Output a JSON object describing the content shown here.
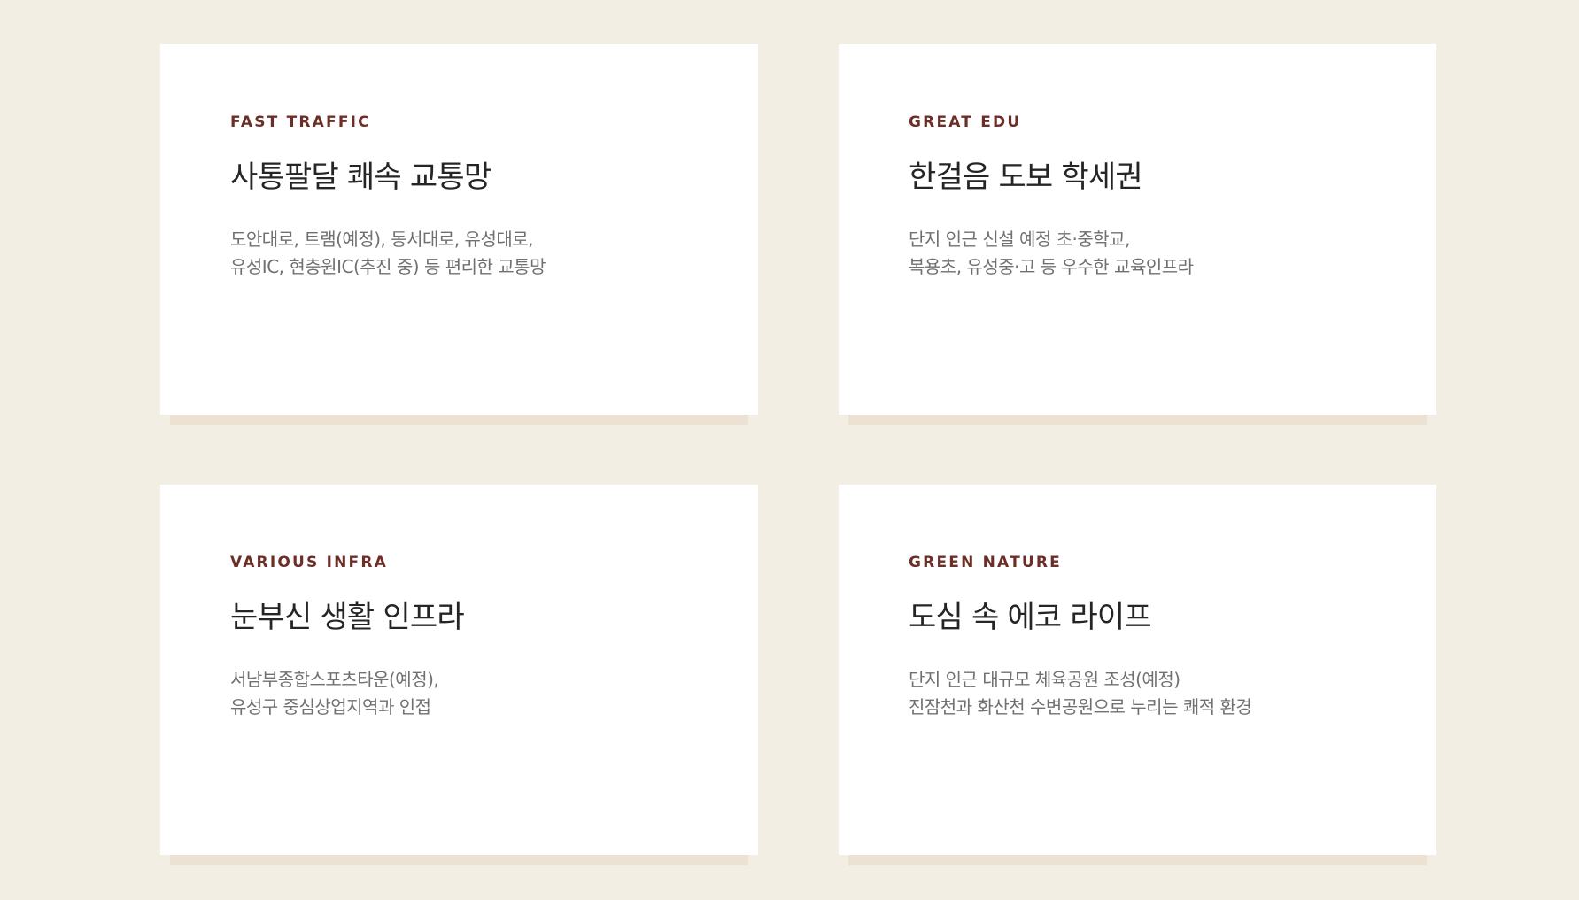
{
  "colors": {
    "page_background": "#f3eee4",
    "card_background": "#ffffff",
    "card_shadow": "#ebe2d4",
    "eyebrow": "#6d2e28",
    "title": "#252525",
    "description": "#707070"
  },
  "features": [
    {
      "eyebrow": "FAST TRAFFIC",
      "title": "사통팔달 쾌속 교통망",
      "description_lines": [
        "도안대로, 트램(예정), 동서대로, 유성대로,",
        "유성IC, 현충원IC(추진 중) 등 편리한 교통망"
      ]
    },
    {
      "eyebrow": "GREAT EDU",
      "title": "한걸음 도보 학세권",
      "description_lines": [
        "단지 인근 신설 예정 초·중학교,",
        "복용초, 유성중·고 등 우수한 교육인프라"
      ]
    },
    {
      "eyebrow": "VARIOUS INFRA",
      "title": "눈부신 생활 인프라",
      "description_lines": [
        "서남부종합스포츠타운(예정),",
        "유성구 중심상업지역과 인접"
      ]
    },
    {
      "eyebrow": "GREEN NATURE",
      "title": "도심 속 에코 라이프",
      "description_lines": [
        "단지 인근 대규모 체육공원 조성(예정)",
        "진잠천과 화산천 수변공원으로 누리는 쾌적 환경"
      ]
    }
  ]
}
